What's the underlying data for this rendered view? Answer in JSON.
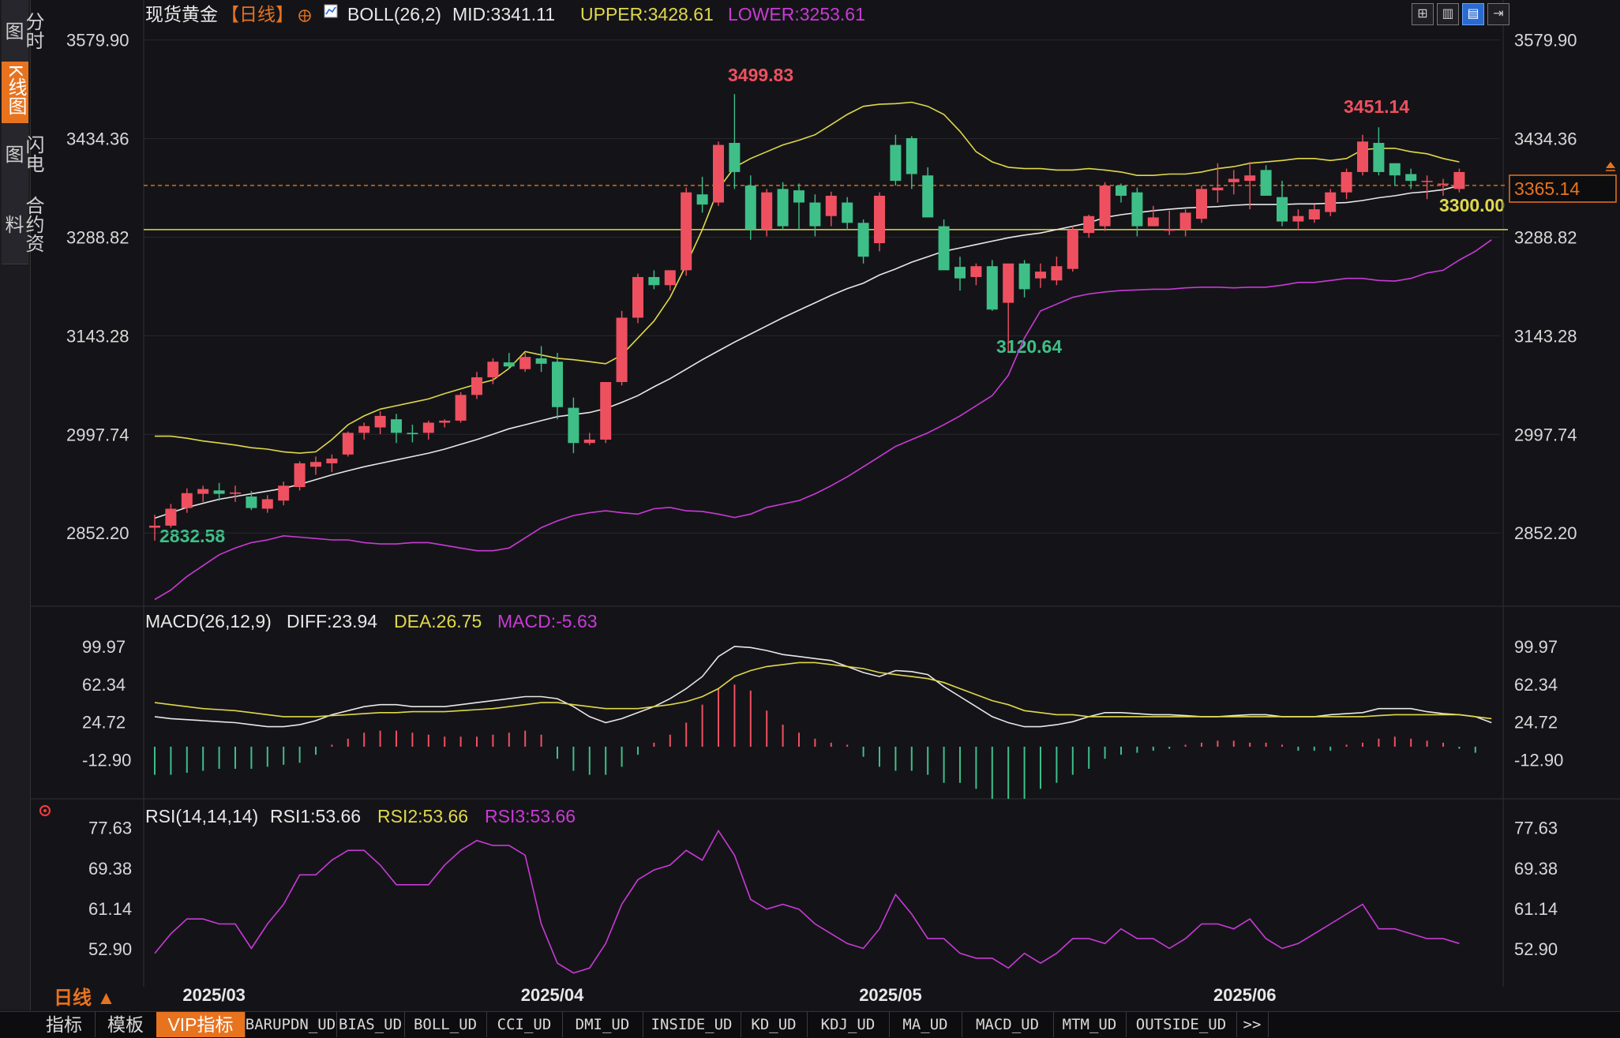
{
  "sidebar": {
    "tabs": [
      {
        "label": "分时图",
        "active": false
      },
      {
        "label": "K线图",
        "active": true
      },
      {
        "label": "闪电图",
        "active": false
      },
      {
        "label": "合约资料",
        "active": false
      }
    ]
  },
  "header": {
    "instrument": "现货黄金",
    "period": "【日线】",
    "boll_label": "BOLL(26,2)",
    "mid": "MID:3341.11",
    "upper": "UPPER:3428.61",
    "lower": "LOWER:3253.61"
  },
  "macd_header": {
    "label": "MACD(26,12,9)",
    "diff": "DIFF:23.94",
    "dea": "DEA:26.75",
    "macd": "MACD:-5.63"
  },
  "rsi_header": {
    "label": "RSI(14,14,14)",
    "rsi1": "RSI1:53.66",
    "rsi2": "RSI2:53.66",
    "rsi3": "RSI3:53.66"
  },
  "price_annotations": {
    "high1": "3499.83",
    "high2": "3451.14",
    "low1": "2832.58",
    "low2": "3120.64",
    "current": "3365.14",
    "level": "3300.00"
  },
  "period_indicator": "日线 ▲",
  "bottom_tabs": [
    "指标",
    "模板",
    "VIP指标",
    "BARUPDN_UD",
    "BIAS_UD",
    "BOLL_UD",
    "CCI_UD",
    "DMI_UD",
    "INSIDE_UD",
    "KD_UD",
    "KDJ_UD",
    "MA_UD",
    "MACD_UD",
    "MTM_UD",
    "OUTSIDE_UD",
    ">>"
  ],
  "bottom_active": "VIP指标",
  "colors": {
    "up": "#ef5060",
    "down": "#3fbf88",
    "mid": "#e8e8e8",
    "upper": "#e0d84a",
    "lower": "#c93ad6",
    "dea": "#e0d84a",
    "macd": "#c93ad6",
    "accent": "#e8731f"
  },
  "chart_data": {
    "type": "candlestick",
    "x_labels": [
      "2025/03",
      "2025/04",
      "2025/05",
      "2025/06"
    ],
    "x_label_index": [
      1,
      22,
      43,
      65
    ],
    "price_ticks": [
      3579.9,
      3434.36,
      3288.82,
      3143.28,
      2997.74,
      2852.2
    ],
    "price_ylim": [
      2800,
      3590
    ],
    "candles": [
      [
        2860,
        2879,
        2841,
        2863
      ],
      [
        2863,
        2895,
        2860,
        2888
      ],
      [
        2889,
        2918,
        2882,
        2911
      ],
      [
        2910,
        2922,
        2898,
        2917
      ],
      [
        2915,
        2926,
        2900,
        2910
      ],
      [
        2910,
        2922,
        2898,
        2912
      ],
      [
        2906,
        2914,
        2886,
        2889
      ],
      [
        2888,
        2908,
        2882,
        2902
      ],
      [
        2900,
        2928,
        2893,
        2922
      ],
      [
        2920,
        2958,
        2915,
        2955
      ],
      [
        2950,
        2965,
        2938,
        2957
      ],
      [
        2955,
        2968,
        2942,
        2962
      ],
      [
        2968,
        3002,
        2965,
        3000
      ],
      [
        3000,
        3015,
        2990,
        3010
      ],
      [
        3008,
        3032,
        2998,
        3025
      ],
      [
        3020,
        3028,
        2985,
        3000
      ],
      [
        3000,
        3012,
        2986,
        2998
      ],
      [
        3000,
        3018,
        2990,
        3015
      ],
      [
        3015,
        3020,
        3008,
        3018
      ],
      [
        3018,
        3060,
        3015,
        3056
      ],
      [
        3056,
        3090,
        3050,
        3082
      ],
      [
        3082,
        3110,
        3072,
        3105
      ],
      [
        3104,
        3118,
        3094,
        3098
      ],
      [
        3094,
        3118,
        3090,
        3112
      ],
      [
        3110,
        3128,
        3090,
        3102
      ],
      [
        3105,
        3118,
        3020,
        3038
      ],
      [
        3037,
        3052,
        2970,
        2985
      ],
      [
        2985,
        3000,
        2982,
        2990
      ],
      [
        2990,
        3075,
        2985,
        3075
      ],
      [
        3075,
        3180,
        3070,
        3170
      ],
      [
        3170,
        3235,
        3162,
        3230
      ],
      [
        3230,
        3240,
        3212,
        3218
      ],
      [
        3218,
        3240,
        3210,
        3240
      ],
      [
        3240,
        3362,
        3232,
        3355
      ],
      [
        3352,
        3378,
        3325,
        3337
      ],
      [
        3340,
        3430,
        3335,
        3425
      ],
      [
        3428,
        3500,
        3360,
        3385
      ],
      [
        3365,
        3380,
        3285,
        3300
      ],
      [
        3300,
        3360,
        3290,
        3355
      ],
      [
        3360,
        3370,
        3300,
        3305
      ],
      [
        3358,
        3368,
        3300,
        3340
      ],
      [
        3340,
        3352,
        3290,
        3305
      ],
      [
        3320,
        3356,
        3305,
        3350
      ],
      [
        3340,
        3348,
        3300,
        3310
      ],
      [
        3310,
        3315,
        3250,
        3260
      ],
      [
        3280,
        3355,
        3268,
        3350
      ],
      [
        3425,
        3440,
        3365,
        3372
      ],
      [
        3435,
        3438,
        3360,
        3382
      ],
      [
        3380,
        3392,
        3318,
        3318
      ],
      [
        3305,
        3315,
        3250,
        3240
      ],
      [
        3245,
        3260,
        3210,
        3228
      ],
      [
        3230,
        3250,
        3218,
        3246
      ],
      [
        3246,
        3255,
        3180,
        3182
      ],
      [
        3192,
        3248,
        3120,
        3250
      ],
      [
        3250,
        3255,
        3200,
        3212
      ],
      [
        3228,
        3250,
        3214,
        3238
      ],
      [
        3225,
        3260,
        3218,
        3246
      ],
      [
        3242,
        3305,
        3238,
        3300
      ],
      [
        3295,
        3322,
        3288,
        3320
      ],
      [
        3305,
        3370,
        3298,
        3365
      ],
      [
        3365,
        3368,
        3340,
        3350
      ],
      [
        3355,
        3362,
        3290,
        3305
      ],
      [
        3305,
        3335,
        3305,
        3318
      ],
      [
        3300,
        3328,
        3292,
        3300
      ],
      [
        3300,
        3330,
        3290,
        3325
      ],
      [
        3316,
        3365,
        3310,
        3360
      ],
      [
        3358,
        3398,
        3340,
        3362
      ],
      [
        3370,
        3388,
        3352,
        3375
      ],
      [
        3372,
        3400,
        3330,
        3380
      ],
      [
        3388,
        3395,
        3350,
        3350
      ],
      [
        3348,
        3372,
        3305,
        3312
      ],
      [
        3312,
        3330,
        3300,
        3320
      ],
      [
        3315,
        3337,
        3310,
        3330
      ],
      [
        3326,
        3360,
        3320,
        3355
      ],
      [
        3355,
        3390,
        3345,
        3385
      ],
      [
        3385,
        3440,
        3380,
        3430
      ],
      [
        3428,
        3451,
        3380,
        3385
      ],
      [
        3398,
        3395,
        3365,
        3380
      ],
      [
        3382,
        3390,
        3360,
        3372
      ],
      [
        3372,
        3380,
        3345,
        3372
      ],
      [
        3368,
        3375,
        3350,
        3368
      ],
      [
        3360,
        3390,
        3355,
        3385
      ]
    ],
    "boll_mid": [
      2874,
      2882,
      2890,
      2896,
      2902,
      2906,
      2910,
      2914,
      2918,
      2924,
      2931,
      2938,
      2944,
      2950,
      2955,
      2960,
      2965,
      2970,
      2976,
      2983,
      2990,
      2998,
      3006,
      3012,
      3018,
      3024,
      3027,
      3030,
      3036,
      3045,
      3055,
      3068,
      3080,
      3094,
      3108,
      3121,
      3134,
      3146,
      3158,
      3170,
      3181,
      3192,
      3203,
      3213,
      3221,
      3233,
      3242,
      3252,
      3260,
      3268,
      3273,
      3278,
      3283,
      3288,
      3292,
      3295,
      3300,
      3305,
      3310,
      3318,
      3322,
      3325,
      3328,
      3330,
      3332,
      3333,
      3334,
      3336,
      3337,
      3337,
      3337,
      3338,
      3338,
      3339,
      3340,
      3343,
      3347,
      3350,
      3354,
      3356,
      3359,
      3365
    ],
    "boll_upper": [
      2995,
      2995,
      2992,
      2988,
      2985,
      2982,
      2978,
      2976,
      2972,
      2970,
      2972,
      2990,
      3012,
      3025,
      3035,
      3040,
      3045,
      3050,
      3058,
      3065,
      3072,
      3078,
      3095,
      3120,
      3115,
      3110,
      3108,
      3105,
      3102,
      3115,
      3140,
      3165,
      3200,
      3248,
      3300,
      3360,
      3392,
      3405,
      3415,
      3425,
      3432,
      3440,
      3455,
      3470,
      3482,
      3485,
      3486,
      3488,
      3482,
      3470,
      3445,
      3415,
      3400,
      3392,
      3390,
      3390,
      3388,
      3388,
      3390,
      3388,
      3385,
      3380,
      3380,
      3382,
      3382,
      3385,
      3390,
      3393,
      3398,
      3400,
      3402,
      3405,
      3405,
      3402,
      3405,
      3418,
      3420,
      3420,
      3415,
      3412,
      3405,
      3400
    ],
    "boll_lower": [
      2754,
      2768,
      2788,
      2804,
      2820,
      2830,
      2838,
      2842,
      2848,
      2846,
      2844,
      2842,
      2842,
      2838,
      2836,
      2836,
      2838,
      2838,
      2834,
      2830,
      2826,
      2826,
      2830,
      2845,
      2860,
      2870,
      2878,
      2882,
      2885,
      2882,
      2880,
      2888,
      2890,
      2885,
      2884,
      2880,
      2875,
      2880,
      2890,
      2895,
      2900,
      2910,
      2922,
      2935,
      2950,
      2965,
      2980,
      2990,
      3000,
      3012,
      3025,
      3040,
      3055,
      3085,
      3140,
      3180,
      3190,
      3200,
      3205,
      3208,
      3210,
      3211,
      3212,
      3212,
      3214,
      3215,
      3215,
      3214,
      3215,
      3215,
      3218,
      3222,
      3222,
      3225,
      3228,
      3228,
      3225,
      3224,
      3228,
      3236,
      3240,
      3255,
      3268,
      3285
    ]
  },
  "macd_data": {
    "ticks": [
      99.97,
      62.34,
      24.72,
      -12.9
    ],
    "ylim": [
      -52,
      115
    ],
    "diff": [
      30,
      28,
      27,
      26,
      25,
      24,
      22,
      20,
      20,
      22,
      26,
      32,
      36,
      40,
      42,
      42,
      40,
      40,
      40,
      42,
      44,
      46,
      48,
      50,
      50,
      48,
      40,
      30,
      24,
      28,
      34,
      40,
      48,
      58,
      70,
      90,
      100,
      99,
      96,
      92,
      90,
      88,
      86,
      80,
      74,
      70,
      76,
      75,
      72,
      60,
      50,
      40,
      30,
      24,
      20,
      20,
      22,
      25,
      30,
      34,
      34,
      33,
      32,
      32,
      31,
      30,
      30,
      31,
      32,
      32,
      30,
      30,
      30,
      32,
      33,
      34,
      38,
      38,
      38,
      35,
      33,
      32,
      30,
      24
    ],
    "dea": [
      44,
      42,
      40,
      38,
      37,
      36,
      34,
      32,
      30,
      30,
      30,
      31,
      32,
      33,
      34,
      34,
      35,
      35,
      35,
      36,
      37,
      38,
      40,
      42,
      44,
      44,
      42,
      40,
      38,
      38,
      38,
      40,
      42,
      45,
      50,
      58,
      70,
      76,
      80,
      82,
      84,
      84,
      82,
      80,
      78,
      74,
      72,
      70,
      68,
      64,
      58,
      52,
      46,
      42,
      36,
      34,
      32,
      32,
      30,
      30,
      30,
      30,
      30,
      30,
      30,
      30,
      30,
      30,
      30,
      30,
      30,
      30,
      30,
      30,
      30,
      30,
      31,
      32,
      32,
      32,
      32,
      32,
      30,
      28
    ],
    "hist": [
      -28,
      -28,
      -26,
      -24,
      -22,
      -22,
      -22,
      -20,
      -18,
      -16,
      -8,
      2,
      8,
      14,
      16,
      16,
      14,
      12,
      10,
      10,
      10,
      12,
      14,
      16,
      12,
      -12,
      -24,
      -28,
      -28,
      -20,
      -8,
      4,
      12,
      24,
      42,
      58,
      62,
      56,
      36,
      22,
      14,
      8,
      4,
      2,
      -10,
      -20,
      -24,
      -24,
      -28,
      -36,
      -36,
      -42,
      -52,
      -52,
      -52,
      -42,
      -36,
      -28,
      -22,
      -12,
      -8,
      -6,
      -4,
      -2,
      2,
      4,
      6,
      6,
      4,
      4,
      2,
      -4,
      -4,
      -4,
      2,
      4,
      8,
      10,
      8,
      6,
      4,
      -2,
      -6
    ]
  },
  "rsi_data": {
    "ticks": [
      77.63,
      69.38,
      61.14,
      52.9
    ],
    "ylim": [
      46,
      79
    ],
    "rsi": [
      52,
      56,
      59,
      59,
      58,
      58,
      53,
      58,
      62,
      68,
      68,
      71,
      73,
      73,
      70,
      66,
      66,
      66,
      70,
      73,
      75,
      74,
      74,
      72,
      58,
      50,
      48,
      49,
      54,
      62,
      67,
      69,
      70,
      73,
      71,
      77,
      72,
      63,
      61,
      62,
      61,
      58,
      56,
      54,
      53,
      57,
      64,
      60,
      55,
      55,
      52,
      51,
      51,
      49,
      52,
      50,
      52,
      55,
      55,
      54,
      57,
      55,
      55,
      53,
      55,
      58,
      58,
      57,
      59,
      55,
      53,
      54,
      56,
      58,
      60,
      62,
      57,
      57,
      56,
      55,
      55,
      54
    ]
  }
}
